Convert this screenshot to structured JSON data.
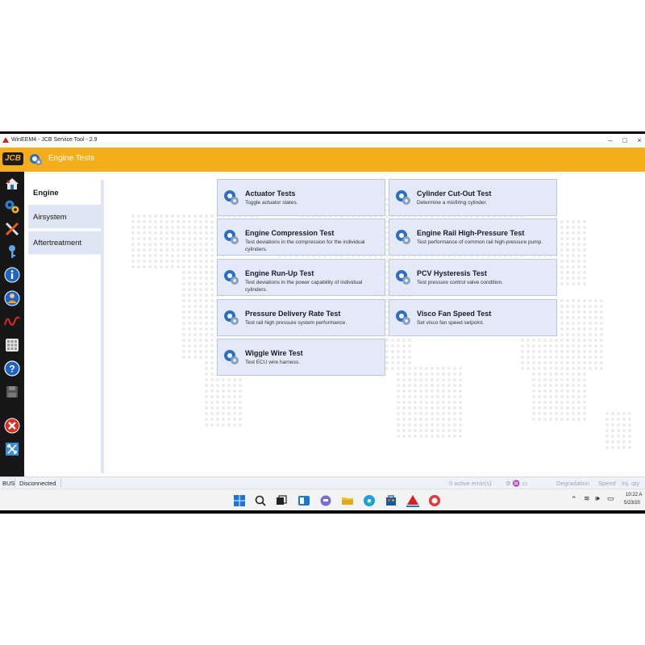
{
  "window": {
    "title": "WinEEM4 - JCB Service Tool - 2.9",
    "minimize": "–",
    "maximize": "□",
    "close": "×"
  },
  "header": {
    "logo": "JCB",
    "title": "Engine Tests"
  },
  "categories": [
    {
      "label": "Engine",
      "active": true
    },
    {
      "label": "Airsystem",
      "active": false
    },
    {
      "label": "Aftertreatment",
      "active": false
    }
  ],
  "tests": [
    {
      "title": "Actuator Tests",
      "description": "Toggle actuator states."
    },
    {
      "title": "Cylinder Cut-Out Test",
      "description": "Determine a misfiring cylinder."
    },
    {
      "title": "Engine Compression Test",
      "description": "Test deviations in the compression for the individual cylinders."
    },
    {
      "title": "Engine Rail High-Pressure Test",
      "description": "Test performance of common rail high-pressure pump."
    },
    {
      "title": "Engine Run-Up Test",
      "description": "Test deviations in the power capability of individual cylinders."
    },
    {
      "title": "PCV Hysteresis Test",
      "description": "Test pressure control valve condition."
    },
    {
      "title": "Pressure Delivery Rate Test",
      "description": "Test rail high pressure system performance."
    },
    {
      "title": "Visco Fan Speed Test",
      "description": "Set visco fan speed setpoint."
    },
    {
      "title": "Wiggle Wire Test",
      "description": "Test ECU wire harness."
    }
  ],
  "rail_icons": [
    "home-icon",
    "settings-gears-icon",
    "tools-icon",
    "key-icon",
    "info-icon",
    "user-info-icon",
    "waveform-icon",
    "keypad-icon",
    "help-icon",
    "save-icon",
    "exit-icon",
    "fullscreen-icon"
  ],
  "status": {
    "bus": "BUS",
    "connection": "Disconnected",
    "active_errors": "0 active error(s)",
    "degradation": "Degradation",
    "speed": "Speed",
    "inj_qty": "Inj. qty"
  },
  "taskbar": {
    "time": "10:22 A",
    "date": "5/23/20"
  },
  "colors": {
    "accent": "#f5ad1b",
    "tile": "#e3e9f6",
    "rail": "#171717"
  }
}
